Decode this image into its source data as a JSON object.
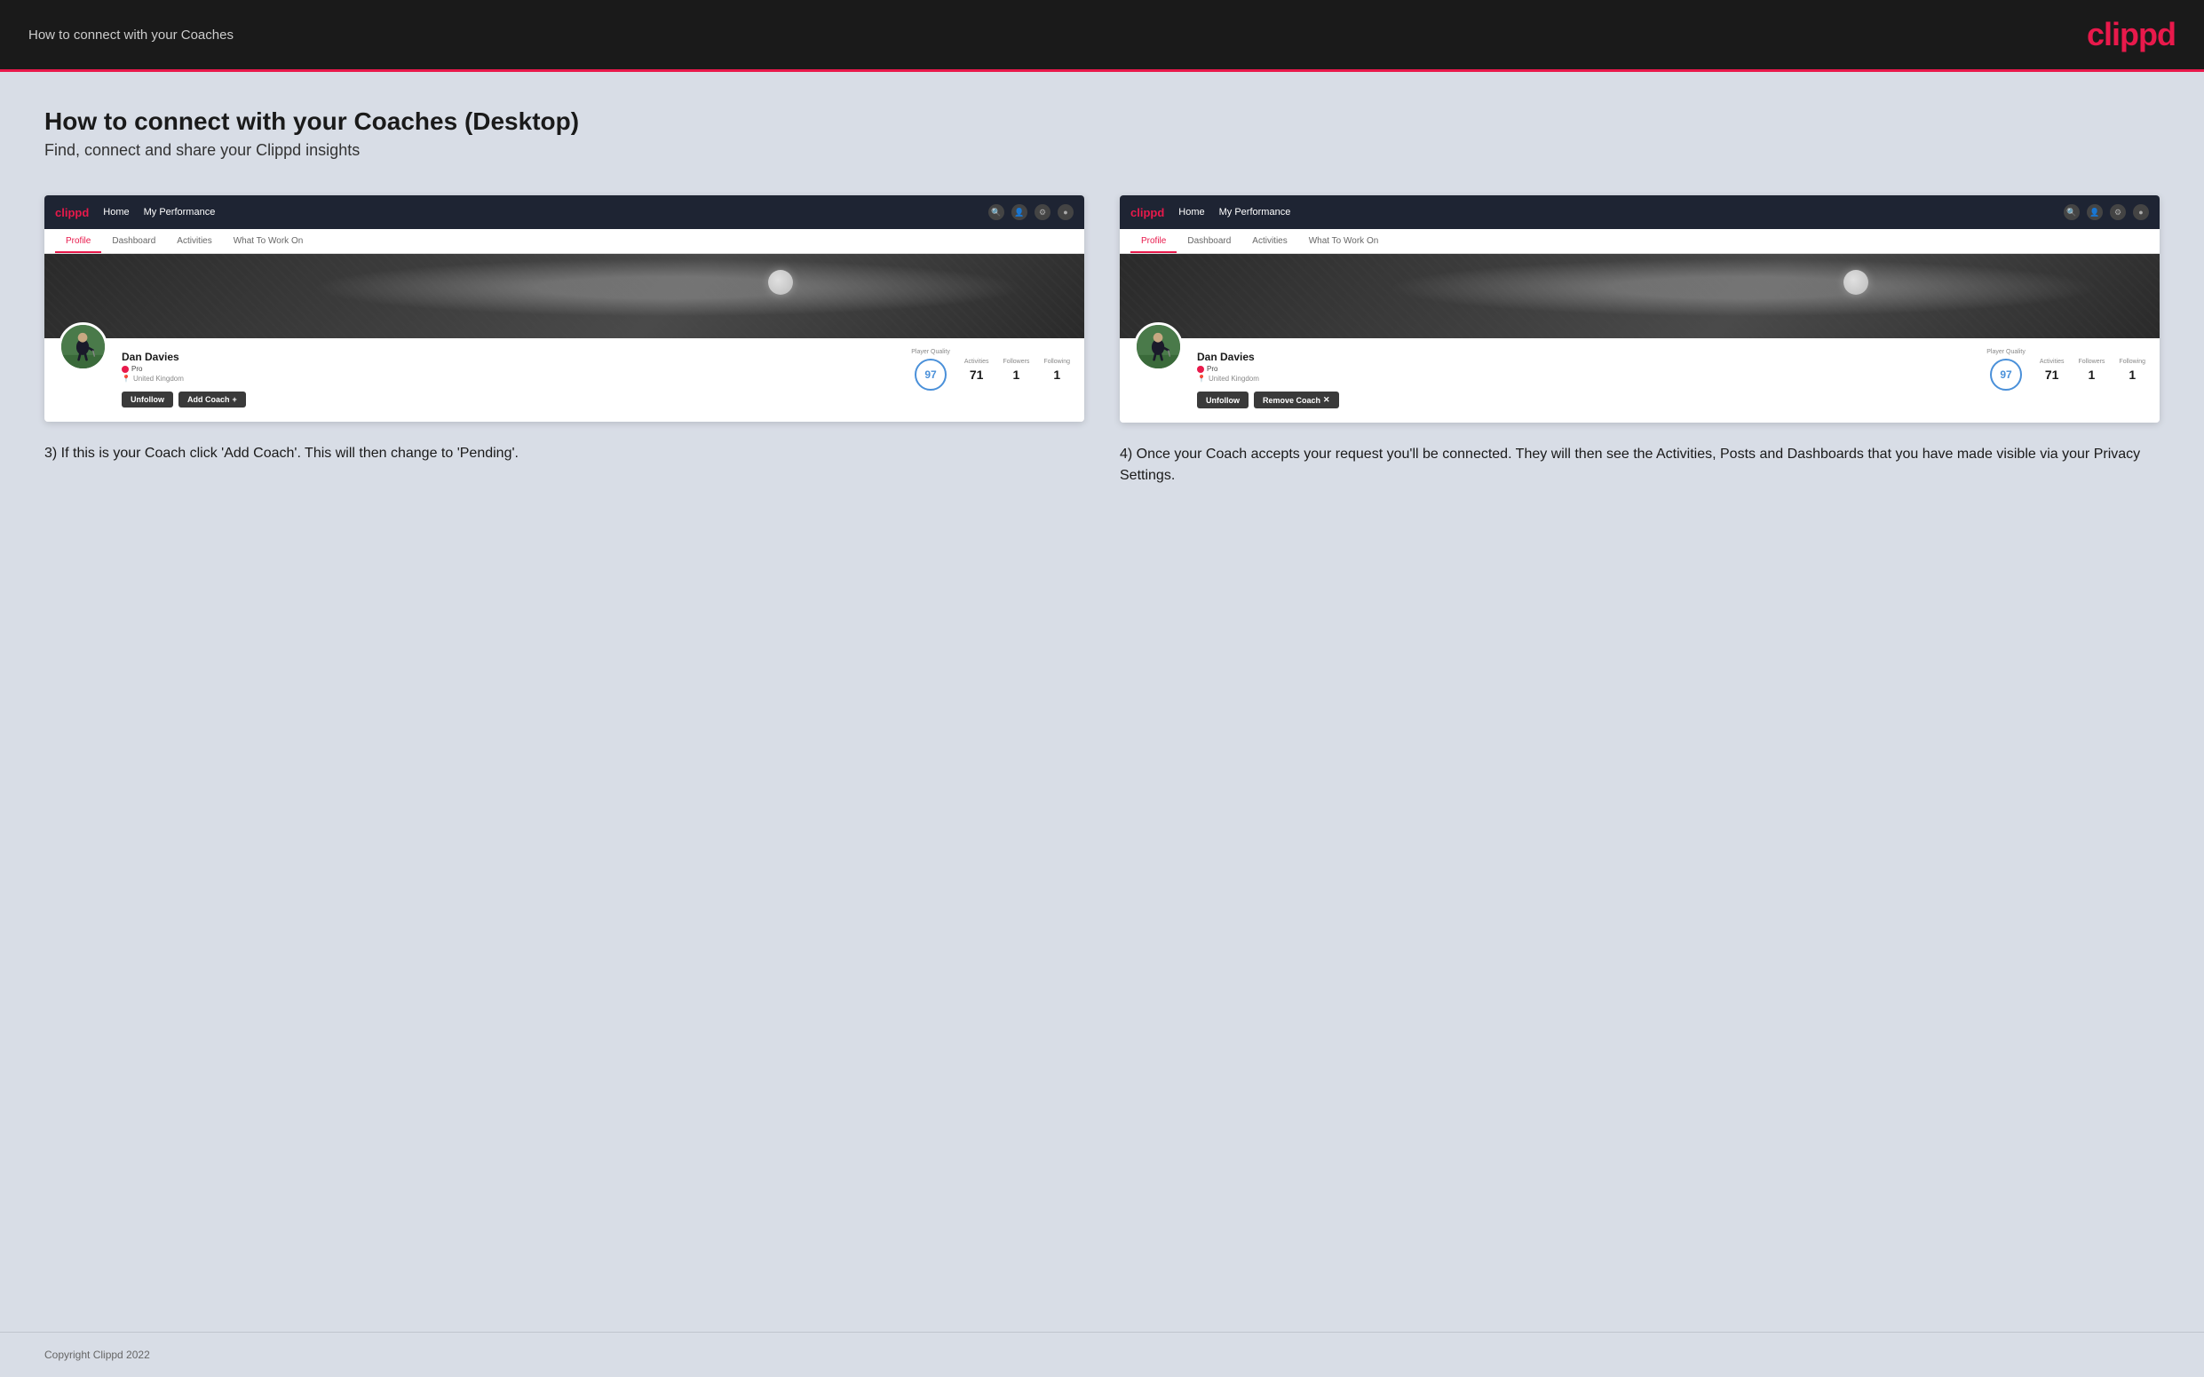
{
  "topBar": {
    "title": "How to connect with your Coaches",
    "logo": "clippd"
  },
  "main": {
    "heading": "How to connect with your Coaches (Desktop)",
    "subheading": "Find, connect and share your Clippd insights"
  },
  "leftPanel": {
    "stepNumber": "3",
    "description": "3) If this is your Coach click 'Add Coach'. This will then change to 'Pending'.",
    "mockup": {
      "nav": {
        "logo": "clippd",
        "links": [
          "Home",
          "My Performance"
        ],
        "tabs": [
          "Profile",
          "Dashboard",
          "Activities",
          "What To Work On"
        ]
      },
      "profile": {
        "name": "Dan Davies",
        "badge": "Pro",
        "location": "United Kingdom",
        "playerQuality": "97",
        "activities": "71",
        "followers": "1",
        "following": "1"
      },
      "buttons": {
        "unfollow": "Unfollow",
        "addCoach": "Add Coach"
      }
    }
  },
  "rightPanel": {
    "stepNumber": "4",
    "description": "4) Once your Coach accepts your request you'll be connected. They will then see the Activities, Posts and Dashboards that you have made visible via your Privacy Settings.",
    "mockup": {
      "nav": {
        "logo": "clippd",
        "links": [
          "Home",
          "My Performance"
        ],
        "tabs": [
          "Profile",
          "Dashboard",
          "Activities",
          "What To Work On"
        ]
      },
      "profile": {
        "name": "Dan Davies",
        "badge": "Pro",
        "location": "United Kingdom",
        "playerQuality": "97",
        "activities": "71",
        "followers": "1",
        "following": "1"
      },
      "buttons": {
        "unfollow": "Unfollow",
        "removeCoach": "Remove Coach"
      }
    }
  },
  "footer": {
    "copyright": "Copyright Clippd 2022"
  }
}
